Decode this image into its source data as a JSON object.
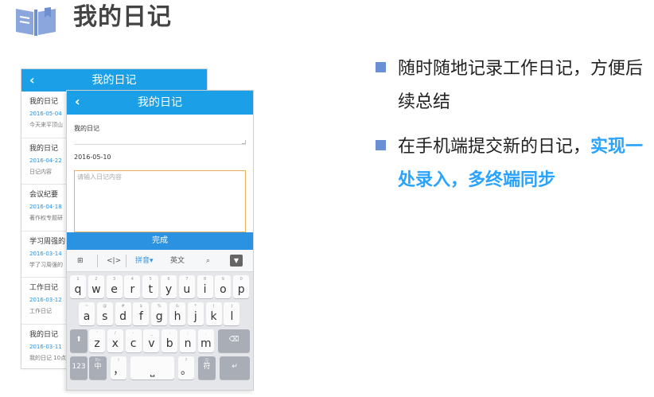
{
  "header": {
    "title": "我的日记",
    "icon": "book-icon"
  },
  "list_screen": {
    "nav_title": "我的日记",
    "back_glyph": "‹",
    "items": [
      {
        "title": "我的日记",
        "date": "2016-05-04",
        "preview": "今天来平顶山"
      },
      {
        "title": "我的日记",
        "date": "2016-04-22",
        "preview": "日记内容"
      },
      {
        "title": "会议纪要",
        "date": "2016-04-18",
        "preview": "著作权专题研"
      },
      {
        "title": "学习周强的",
        "date": "2016-03-14",
        "preview": "学了习周强的"
      },
      {
        "title": "工作日记",
        "date": "2016-03-12",
        "preview": "工作日记"
      },
      {
        "title": "我的日记",
        "date": "2016-03-11",
        "preview": "我的日记 10点"
      }
    ]
  },
  "edit_screen": {
    "nav_title": "我的日记",
    "back_glyph": "‹",
    "title_value": "我的日记",
    "date_value": "2016-05-10",
    "content_placeholder": "请输入日记内容",
    "done_label": "完成"
  },
  "keyboard": {
    "toolbar": {
      "pinyin": "拼音",
      "english": "英文"
    },
    "row1": [
      {
        "key": "q",
        "hint": "1"
      },
      {
        "key": "w",
        "hint": "2"
      },
      {
        "key": "e",
        "hint": "3"
      },
      {
        "key": "r",
        "hint": "4"
      },
      {
        "key": "t",
        "hint": "5"
      },
      {
        "key": "y",
        "hint": "6"
      },
      {
        "key": "u",
        "hint": "7"
      },
      {
        "key": "i",
        "hint": "8"
      },
      {
        "key": "o",
        "hint": "9"
      },
      {
        "key": "p",
        "hint": "0"
      }
    ],
    "row2": [
      {
        "key": "a",
        "hint": "~"
      },
      {
        "key": "s",
        "hint": "@"
      },
      {
        "key": "d",
        "hint": "#"
      },
      {
        "key": "f",
        "hint": "$"
      },
      {
        "key": "g",
        "hint": "%"
      },
      {
        "key": "h",
        "hint": "&"
      },
      {
        "key": "j",
        "hint": "*"
      },
      {
        "key": "k",
        "hint": "("
      },
      {
        "key": "l",
        "hint": ")"
      }
    ],
    "row3": [
      {
        "key": "z",
        "hint": "'"
      },
      {
        "key": "x",
        "hint": "/"
      },
      {
        "key": "c",
        "hint": "-"
      },
      {
        "key": "v",
        "hint": "_"
      },
      {
        "key": "b",
        "hint": ":"
      },
      {
        "key": "n",
        "hint": ";"
      },
      {
        "key": "m",
        "hint": "."
      }
    ],
    "bottom": {
      "num": "123",
      "lang": "中",
      "lang_hint": "En",
      "comma": "，",
      "comma_hint": "!",
      "period": "。",
      "period_hint": "?",
      "symbols": "符",
      "symbols_hint": "☺"
    }
  },
  "bullets": [
    {
      "text": "随时随地记录工作日记，方便后续总结",
      "highlight": ""
    },
    {
      "text": "在手机端提交新的日记，",
      "highlight": "实现一处录入，多终端同步"
    }
  ],
  "colors": {
    "nav_blue": "#1b9fe6",
    "done_blue": "#2a92e0",
    "highlight": "#2aa3ff",
    "bullet": "#6b8fd4",
    "icon": "#8aa6dd"
  }
}
